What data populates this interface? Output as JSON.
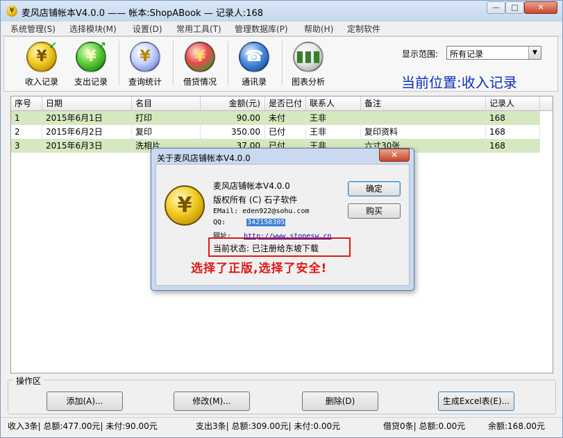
{
  "window": {
    "title": "麦风店铺帐本V4.0.0 —— 帐本:ShopABook — 记录人:168",
    "icon": "yuan-coin-icon",
    "controls": {
      "minimize": "—",
      "maximize": "□",
      "close": "✕"
    }
  },
  "menu": [
    "系统管理(S)",
    "选择模块(M)",
    "设置(D)",
    "常用工具(T)",
    "管理数据库(P)",
    "帮助(H)",
    "定制软件"
  ],
  "toolbar": {
    "buttons": [
      {
        "label": "收入记录",
        "icon": "income-coin-icon"
      },
      {
        "label": "支出记录",
        "icon": "expense-coin-icon"
      },
      {
        "label": "查询统计",
        "icon": "search-stats-icon"
      },
      {
        "label": "借贷情况",
        "icon": "loan-exchange-icon"
      },
      {
        "label": "通讯录",
        "icon": "address-book-icon"
      },
      {
        "label": "图表分析",
        "icon": "bar-chart-icon"
      }
    ],
    "range_label": "显示范围:",
    "range_value": "所有记录",
    "location": "当前位置:收入记录"
  },
  "table": {
    "columns": [
      "序号",
      "日期",
      "名目",
      "金额(元)",
      "是否已付",
      "联系人",
      "备注",
      "记录人"
    ],
    "rows": [
      [
        "1",
        "2015年6月1日",
        "打印",
        "90.00",
        "未付",
        "王非",
        "",
        "168"
      ],
      [
        "2",
        "2015年6月2日",
        "复印",
        "350.00",
        "已付",
        "王非",
        "复印资料",
        "168"
      ],
      [
        "3",
        "2015年6月3日",
        "洗相片",
        "37.00",
        "已付",
        "王非",
        "六寸30张",
        "168"
      ]
    ]
  },
  "ops": {
    "label": "操作区",
    "add": "添加(A)...",
    "edit": "修改(M)...",
    "delete": "删除(D)",
    "excel": "生成Excel表(E)..."
  },
  "status": {
    "income": "收入3条| 总额:477.00元| 未付:90.00元",
    "expense": "支出3条| 总额:309.00元| 未付:0.00元",
    "loan": "借贷0条| 总额:0.00元",
    "balance": "余额:168.00元"
  },
  "about_dialog": {
    "title": "关于麦风店铺帐本V4.0.0",
    "product": "麦风店铺帐本V4.0.0",
    "copyright": "版权所有 (C) 石子软件",
    "email_label": "EMail:",
    "email": "eden922@sohu.com",
    "qq_label": "QQ:",
    "qq": "342150305",
    "web_label": "网址:",
    "web": "http://www.stonesw.cn",
    "status": "当前状态: 已注册给东坡下载",
    "ok": "确定",
    "buy": "购买",
    "slogan": "选择了正版,选择了安全!"
  }
}
